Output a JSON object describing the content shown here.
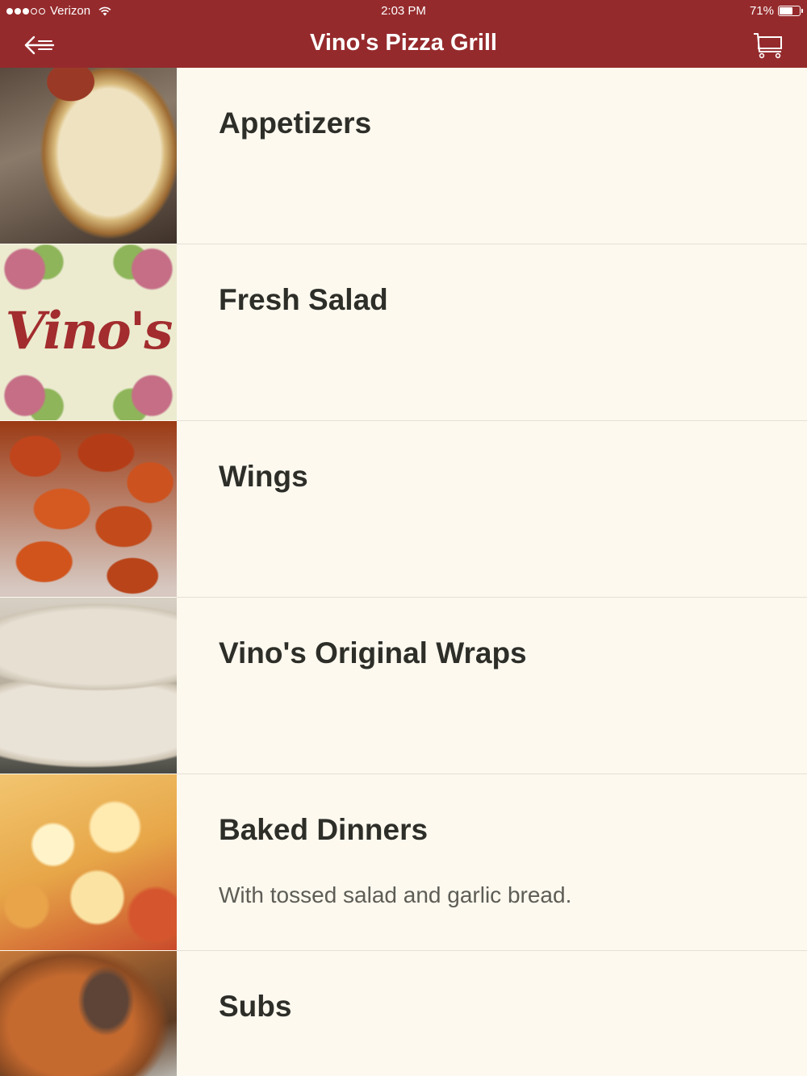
{
  "status_bar": {
    "carrier": "Verizon",
    "time": "2:03 PM",
    "battery_percent": "71%",
    "battery_level": 0.71,
    "signal_bars": 3
  },
  "nav": {
    "title": "Vino's Pizza Grill",
    "back_icon": "back-arrow-icon",
    "cart_icon": "shopping-cart-icon"
  },
  "menu": {
    "items": [
      {
        "name": "Appetizers",
        "description": "",
        "image": "garlic-bread-photo"
      },
      {
        "name": "Fresh Salad",
        "description": "",
        "image": "vinos-logo",
        "image_text": "Vino's"
      },
      {
        "name": "Wings",
        "description": "",
        "image": "wings-photo"
      },
      {
        "name": "Vino's Original Wraps",
        "description": "",
        "image": "wraps-photo"
      },
      {
        "name": "Baked Dinners",
        "description": "With tossed salad and garlic bread.",
        "image": "baked-dinner-photo"
      },
      {
        "name": "Subs",
        "description": "",
        "image": "subs-photo"
      }
    ]
  },
  "colors": {
    "header": "#952a2c",
    "background": "#fdf9ef",
    "title_text": "#2e2e29",
    "description_text": "#5d5d56",
    "divider": "#e4e0d6"
  }
}
